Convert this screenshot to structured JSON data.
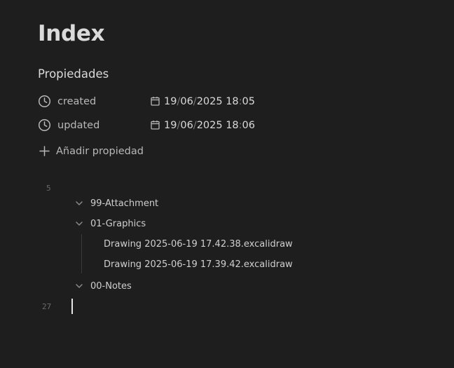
{
  "note": {
    "title": "Index"
  },
  "properties": {
    "heading": "Propiedades",
    "items": [
      {
        "key": "created",
        "icon": "clock-icon",
        "value_icon": "calendar-icon",
        "day": "19",
        "month": "06",
        "year": "2025",
        "hour": "18",
        "minute": "05"
      },
      {
        "key": "updated",
        "icon": "clock-icon",
        "value_icon": "calendar-icon",
        "day": "19",
        "month": "06",
        "year": "2025",
        "hour": "18",
        "minute": "06"
      }
    ],
    "add_label": "Añadir propiedad",
    "date_sep": "/",
    "time_sep": ":"
  },
  "editor": {
    "line_numbers": [
      "5",
      "27"
    ],
    "tree": [
      {
        "label": "99-Attachment",
        "icon": "chevron-down-icon"
      },
      {
        "label": "01-Graphics",
        "icon": "chevron-down-icon"
      },
      {
        "label": "00-Notes",
        "icon": "chevron-down-icon"
      }
    ],
    "files": [
      "Drawing 2025-06-19 17.42.38.excalidraw",
      "Drawing 2025-06-19 17.39.42.excalidraw"
    ]
  },
  "colors": {
    "background": "#1e1e1e",
    "text": "#dadada",
    "muted": "#b8b8b8",
    "line_number": "#6a6a6a"
  }
}
